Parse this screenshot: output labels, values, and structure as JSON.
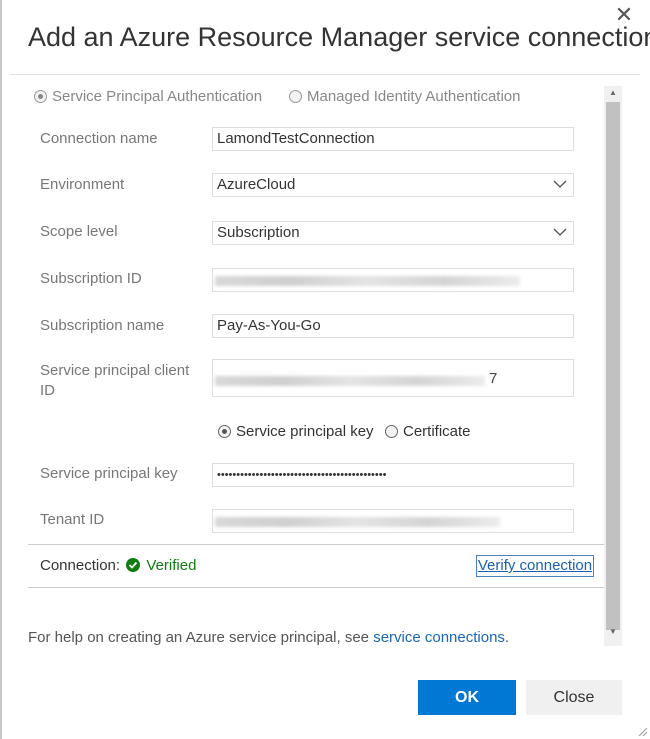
{
  "dialog": {
    "title": "Add an Azure Resource Manager service connection",
    "close_glyph": "✕"
  },
  "auth": {
    "option1": "Service Principal Authentication",
    "option1_selected": true,
    "option2": "Managed Identity Authentication",
    "option2_selected": false
  },
  "form": {
    "connection_name_label": "Connection name",
    "connection_name_value": "LamondTestConnection",
    "environment_label": "Environment",
    "environment_value": "AzureCloud",
    "scope_label": "Scope level",
    "scope_value": "Subscription",
    "subscription_id_label": "Subscription ID",
    "subscription_name_label": "Subscription name",
    "subscription_name_value": "Pay-As-You-Go",
    "client_id_label": "Service principal client ID",
    "client_id_visible_suffix": "7",
    "key_type_option1": "Service principal key",
    "key_type_option2": "Certificate",
    "key_label": "Service principal key",
    "key_value": "••••••••••••••••••••••••••••••••••••••••••••",
    "tenant_label": "Tenant ID"
  },
  "connection": {
    "label": "Connection:",
    "status": "Verified",
    "verify_button": "Verify connection"
  },
  "help": {
    "text": "For help on creating an Azure service principal, see ",
    "link": "service connections."
  },
  "buttons": {
    "ok": "OK",
    "close": "Close"
  },
  "colors": {
    "primary": "#0078d4",
    "success": "#107c10",
    "link": "#1a66b8"
  },
  "icons": [
    "close-icon",
    "chevron-down-icon",
    "check-circle-icon",
    "scroll-up-icon",
    "scroll-down-icon",
    "resize-grip-icon"
  ]
}
